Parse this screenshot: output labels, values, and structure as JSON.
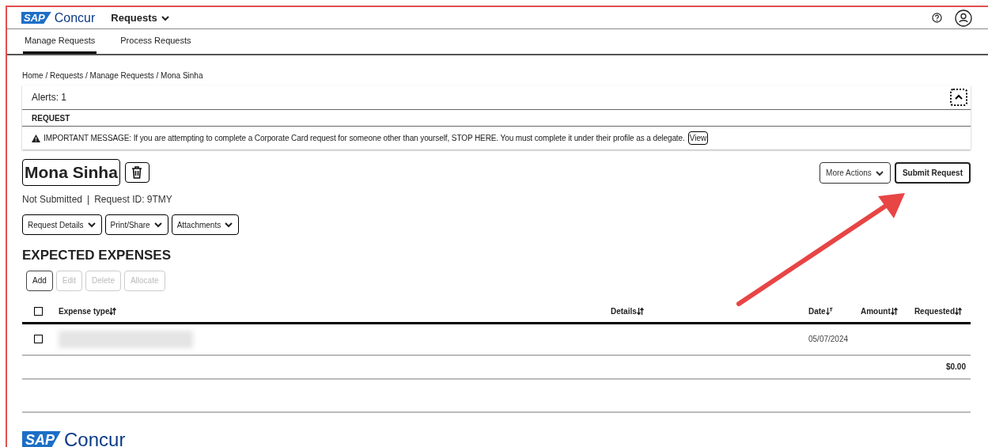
{
  "header": {
    "logo": {
      "sap": "SAP",
      "name": "Concur"
    },
    "menu": "Requests"
  },
  "tabs": [
    {
      "label": "Manage Requests",
      "selected": true
    },
    {
      "label": "Process Requests",
      "selected": false
    }
  ],
  "breadcrumb": "Home / Requests / Manage Requests / Mona Sinha",
  "alerts": {
    "label": "Alerts: 1",
    "expanded": true,
    "section": "REQUEST",
    "message": "IMPORTANT MESSAGE: If you are attempting to complete a Corporate Card request for someone other than yourself, STOP HERE. You must complete it under their profile as a delegate.",
    "link": "View"
  },
  "request": {
    "title": "Mona Sinha",
    "status": "Not Submitted",
    "separator": "|",
    "id": "Request ID: 9TMY"
  },
  "actions": [
    "More Actions",
    "Submit Request"
  ],
  "menus": [
    "Request Details",
    "Print/Share",
    "Attachments"
  ],
  "expenses": {
    "title": "EXPECTED EXPENSES",
    "buttons": [
      {
        "label": "Add",
        "disabled": false
      },
      {
        "label": "Edit",
        "disabled": true
      },
      {
        "label": "Delete",
        "disabled": true
      },
      {
        "label": "Allocate",
        "disabled": true
      }
    ],
    "select_all": {
      "checked": false
    },
    "columns": [
      {
        "label": "Expense type",
        "kind": "sortable"
      },
      {
        "label": "Details",
        "kind": "sortable"
      },
      {
        "label": "Date",
        "kind": "filtered"
      },
      {
        "label": "Amount",
        "kind": "sortable"
      },
      {
        "label": "Requested",
        "kind": "sortable"
      }
    ],
    "rows": [
      {
        "checked": false,
        "date": "05/07/2024"
      }
    ],
    "total": "$0.00"
  },
  "footer": {
    "logo": {
      "sap": "SAP",
      "name": "Concur"
    }
  }
}
